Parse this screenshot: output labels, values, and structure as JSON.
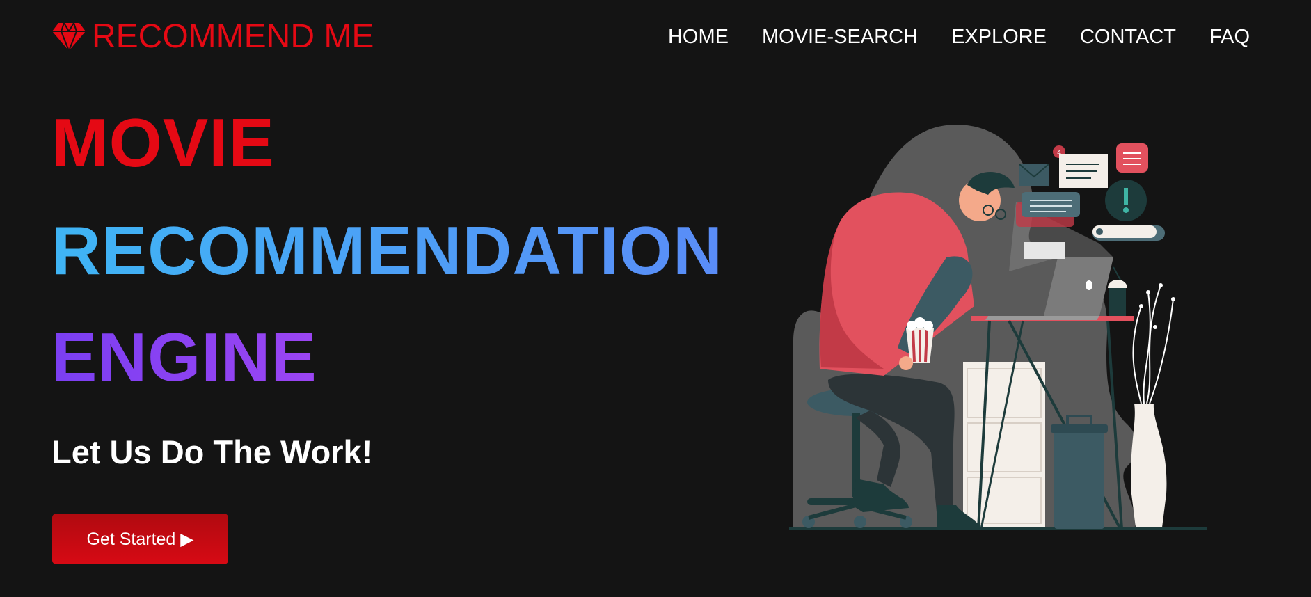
{
  "brand": {
    "name": "RECOMMEND ME",
    "color": "#e50914"
  },
  "nav": {
    "items": [
      {
        "label": "HOME"
      },
      {
        "label": "MOVIE-SEARCH"
      },
      {
        "label": "EXPLORE"
      },
      {
        "label": "CONTACT"
      },
      {
        "label": "FAQ"
      }
    ]
  },
  "hero": {
    "line1": {
      "text": "MOVIE",
      "color": "#e50914"
    },
    "line2": {
      "text": "RECOMMENDATION",
      "color_from": "#3fb5f5",
      "color_to": "#5a8cf7"
    },
    "line3": {
      "text": "ENGINE",
      "color_from": "#7b3ff2",
      "color_to": "#9b45f2"
    },
    "subtitle": "Let Us Do The Work!",
    "cta_label": "Get Started ▶"
  },
  "illustration": {
    "notification_count": "4"
  },
  "colors": {
    "background": "#141414",
    "accent": "#e50914"
  }
}
